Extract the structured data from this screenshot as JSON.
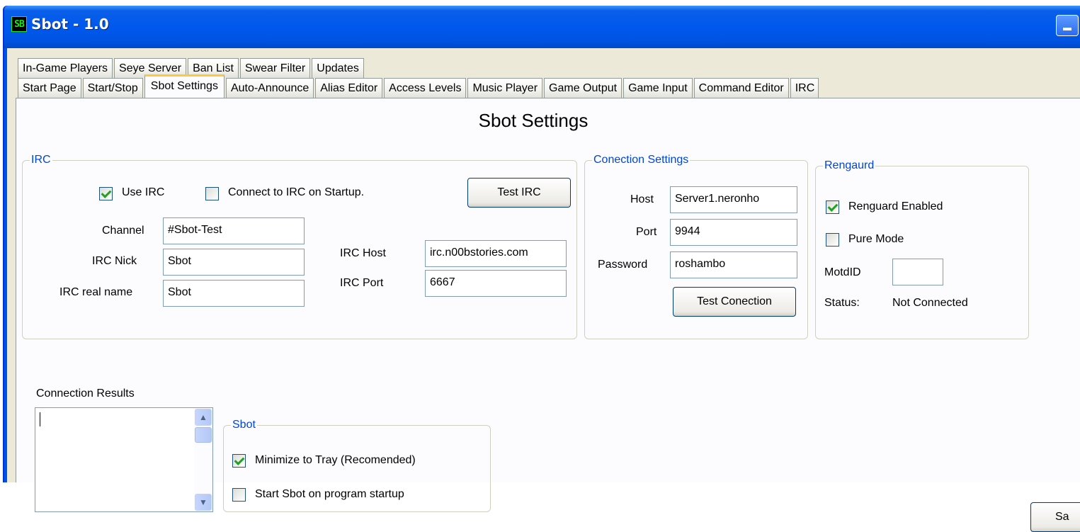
{
  "window": {
    "title": "Sbot - 1.0",
    "icon_text": "SB"
  },
  "tabs": {
    "row1": [
      "In-Game Players",
      "Seye Server",
      "Ban List",
      "Swear Filter",
      "Updates"
    ],
    "row2": [
      "Start Page",
      "Start/Stop",
      "Sbot Settings",
      "Auto-Announce",
      "Alias Editor",
      "Access Levels",
      "Music Player",
      "Game Output",
      "Game Input",
      "Command Editor",
      "IRC"
    ],
    "active": "Sbot Settings"
  },
  "page": {
    "title": "Sbot Settings"
  },
  "irc": {
    "legend": "IRC",
    "use_irc_label": "Use IRC",
    "use_irc_checked": true,
    "connect_startup_label": "Connect to IRC on Startup.",
    "connect_startup_checked": false,
    "test_button": "Test IRC",
    "channel_label": "Channel",
    "channel_value": "#Sbot-Test",
    "nick_label": "IRC Nick",
    "nick_value": "Sbot",
    "realname_label": "IRC real name",
    "realname_value": "Sbot",
    "host_label": "IRC Host",
    "host_value": "irc.n00bstories.com",
    "port_label": "IRC Port",
    "port_value": "6667"
  },
  "connection": {
    "legend": "Conection Settings",
    "host_label": "Host",
    "host_value": "Server1.neronho",
    "port_label": "Port",
    "port_value": "9944",
    "password_label": "Password",
    "password_value": "roshambo",
    "test_button": "Test Conection"
  },
  "renguard": {
    "legend": "Rengaurd",
    "enabled_label": "Renguard Enabled",
    "enabled_checked": true,
    "pure_label": "Pure Mode",
    "pure_checked": false,
    "motd_label": "MotdID",
    "motd_value": "",
    "status_label": "Status:",
    "status_value": "Not Connected"
  },
  "results": {
    "label": "Connection Results",
    "value": ""
  },
  "sbot": {
    "legend": "Sbot",
    "minimize_label": "Minimize to Tray (Recomended)",
    "minimize_checked": true,
    "startup_label": "Start Sbot on program startup",
    "startup_checked": false
  },
  "save_button": "Sa"
}
